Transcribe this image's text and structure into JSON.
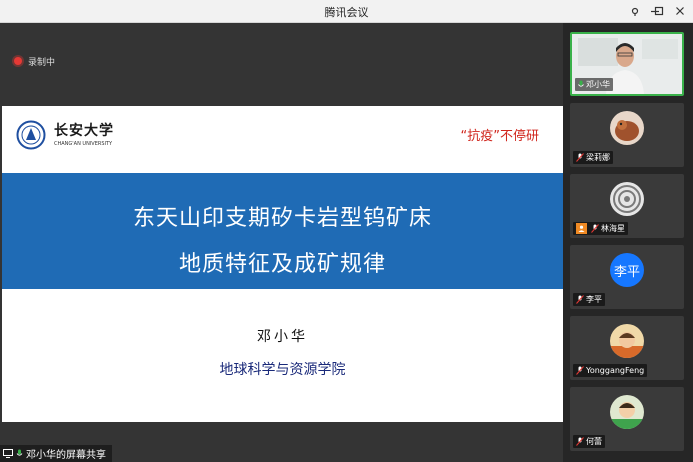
{
  "window": {
    "title": "腾讯会议"
  },
  "recording": {
    "label": "录制中"
  },
  "slide": {
    "logo_text": "长安大学",
    "logo_sub": "CHANG'AN UNIVERSITY",
    "slogan": "“抗疫”不停研",
    "title_line1": "东天山印支期矽卡岩型钨矿床",
    "title_line2": "地质特征及成矿规律",
    "author": "邓小华",
    "affiliation": "地球科学与资源学院"
  },
  "share": {
    "label": "邓小华的屏幕共享"
  },
  "participants": [
    {
      "name": "邓小华",
      "avatar": "video",
      "active": true
    },
    {
      "name": "梁莉娜",
      "avatar": "photo-bird"
    },
    {
      "name": "林海星",
      "avatar": "photo-spiral",
      "host": true
    },
    {
      "name": "李平",
      "avatar": "text",
      "avatar_text": "李平"
    },
    {
      "name": "YonggangFeng",
      "avatar": "photo-child"
    },
    {
      "name": "何蕾",
      "avatar": "photo-child2"
    }
  ],
  "colors": {
    "slide_band": "#1f6bb5",
    "slogan": "#d0261d",
    "active_border": "#39b14a",
    "record": "#e53935"
  }
}
